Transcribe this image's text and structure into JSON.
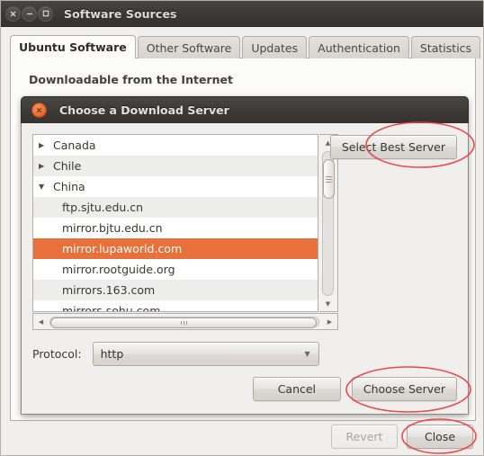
{
  "window": {
    "title": "Software Sources",
    "controls": [
      {
        "name": "close",
        "glyph": "close-icon"
      },
      {
        "name": "minimize",
        "glyph": "minimize-icon"
      },
      {
        "name": "maximize",
        "glyph": "maximize-icon"
      }
    ]
  },
  "tabs": [
    {
      "label": "Ubuntu Software",
      "active": true
    },
    {
      "label": "Other Software",
      "active": false
    },
    {
      "label": "Updates",
      "active": false
    },
    {
      "label": "Authentication",
      "active": false
    },
    {
      "label": "Statistics",
      "active": false
    }
  ],
  "panel": {
    "heading": "Downloadable from the Internet"
  },
  "dialog": {
    "title": "Choose a Download Server",
    "close_icon": "close-icon",
    "select_best_server_label": "Select Best Server",
    "protocol_label": "Protocol:",
    "protocol_value": "http",
    "protocol_caret": "chevron-down-icon",
    "cancel_label": "Cancel",
    "choose_server_label": "Choose Server",
    "servers": [
      {
        "label": "Canada",
        "type": "group",
        "expanded": false,
        "selected": false,
        "alt": false
      },
      {
        "label": "Chile",
        "type": "group",
        "expanded": false,
        "selected": false,
        "alt": true
      },
      {
        "label": "China",
        "type": "group",
        "expanded": true,
        "selected": false,
        "alt": false
      },
      {
        "label": "ftp.sjtu.edu.cn",
        "type": "item",
        "selected": false,
        "alt": true
      },
      {
        "label": "mirror.bjtu.edu.cn",
        "type": "item",
        "selected": false,
        "alt": false
      },
      {
        "label": "mirror.lupaworld.com",
        "type": "item",
        "selected": true,
        "alt": true
      },
      {
        "label": "mirror.rootguide.org",
        "type": "item",
        "selected": false,
        "alt": false
      },
      {
        "label": "mirrors.163.com",
        "type": "item",
        "selected": false,
        "alt": true
      },
      {
        "label": "mirrors.sohu.com",
        "type": "item",
        "selected": false,
        "alt": false
      }
    ]
  },
  "footer": {
    "revert_label": "Revert",
    "revert_disabled": true,
    "close_label": "Close"
  },
  "annotations": [
    {
      "name": "select-best-server",
      "shape": "ellipse"
    },
    {
      "name": "choose-server",
      "shape": "ellipse"
    },
    {
      "name": "close",
      "shape": "ellipse"
    }
  ],
  "colors": {
    "selection": "#e8703a",
    "annotation": "#f0383c",
    "titlebar": "#3b3836",
    "panel": "#fbfbfa",
    "window": "#f0efee"
  }
}
